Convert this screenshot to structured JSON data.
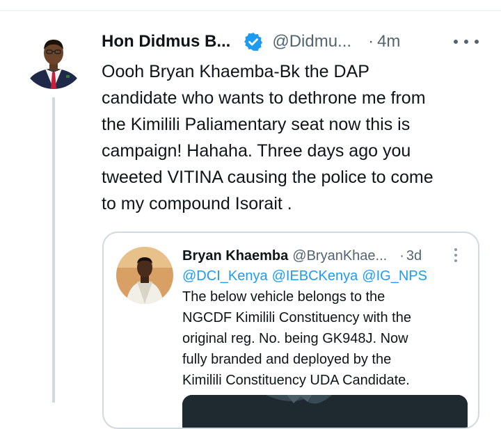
{
  "tweet": {
    "author_name": "Hon Didmus B...",
    "author_handle": "@Didmu...",
    "dot": "·",
    "time": "4m",
    "text": "Oooh Bryan Khaemba-Bk the DAP\ncandidate who wants to dethrone me from\nthe Kimilili Paliamentary seat now this is\ncampaign! Hahaha.  Three days ago you\ntweeted VITINA causing the police to come\nto my compound Isorait ."
  },
  "quote": {
    "author_name": "Bryan Khaemba",
    "author_handle": "@BryanKhae...",
    "dot": "·",
    "time": "3d",
    "mentions": [
      "@DCI_Kenya",
      "@IEBCKenya",
      "@IG_NPS"
    ],
    "text": "The below vehicle belongs to the\nNGCDF Kimilili Constituency with the\noriginal reg. No. being GK948J. Now\nfully branded and deployed by the\nKimilili Constituency UDA Candidate."
  },
  "colors": {
    "verified_badge": "#1d9bf0",
    "mention_link": "#1d9bf0",
    "secondary_text": "#536471"
  },
  "icons": {
    "verified": "verified-badge-icon",
    "more": "more-horizontal-icon",
    "quote_more": "more-vertical-icon"
  }
}
